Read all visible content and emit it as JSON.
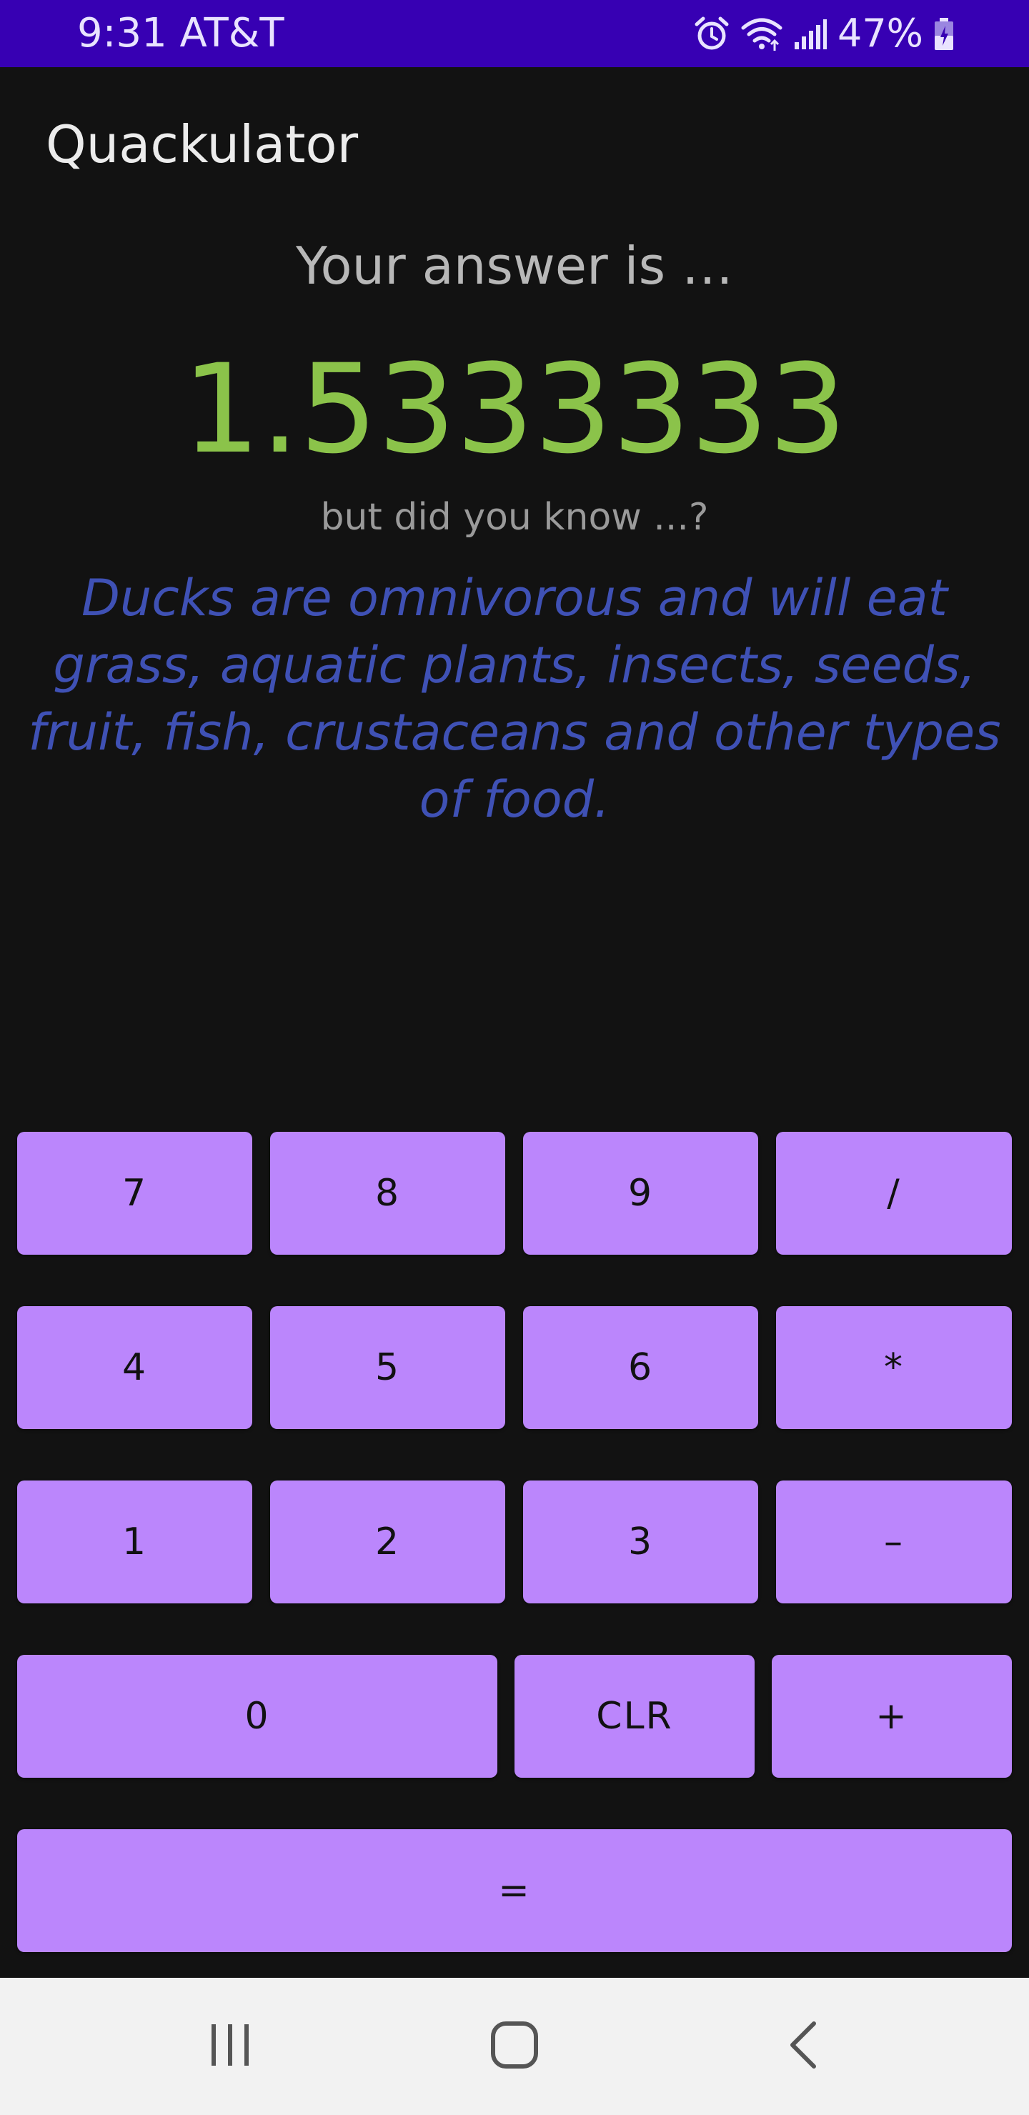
{
  "status_bar": {
    "time": "9:31 AT&T",
    "battery": "47%",
    "icons": [
      "alarm-icon",
      "wifi-icon",
      "signal-icon",
      "battery-icon"
    ]
  },
  "app": {
    "title": "Quackulator"
  },
  "result": {
    "heading": "Your answer is …",
    "value": "1.5333333",
    "subheading": "but did you know ...?",
    "fact": "Ducks are omnivorous and will eat grass, aquatic plants, insects, seeds, fruit, fish, crustaceans and other types of food."
  },
  "keypad": {
    "k7": "7",
    "k8": "8",
    "k9": "9",
    "div": "/",
    "k4": "4",
    "k5": "5",
    "k6": "6",
    "mul": "*",
    "k1": "1",
    "k2": "2",
    "k3": "3",
    "sub": "–",
    "k0": "0",
    "clr": "CLR",
    "add": "+",
    "eq": "="
  },
  "navigation": {
    "icons": [
      "recents-icon",
      "home-icon",
      "back-icon"
    ]
  },
  "colors": {
    "status_bar": "#3700b3",
    "background": "#121212",
    "answer": "#8bc34a",
    "fact": "#3f51b5",
    "key": "#bb86fc"
  }
}
